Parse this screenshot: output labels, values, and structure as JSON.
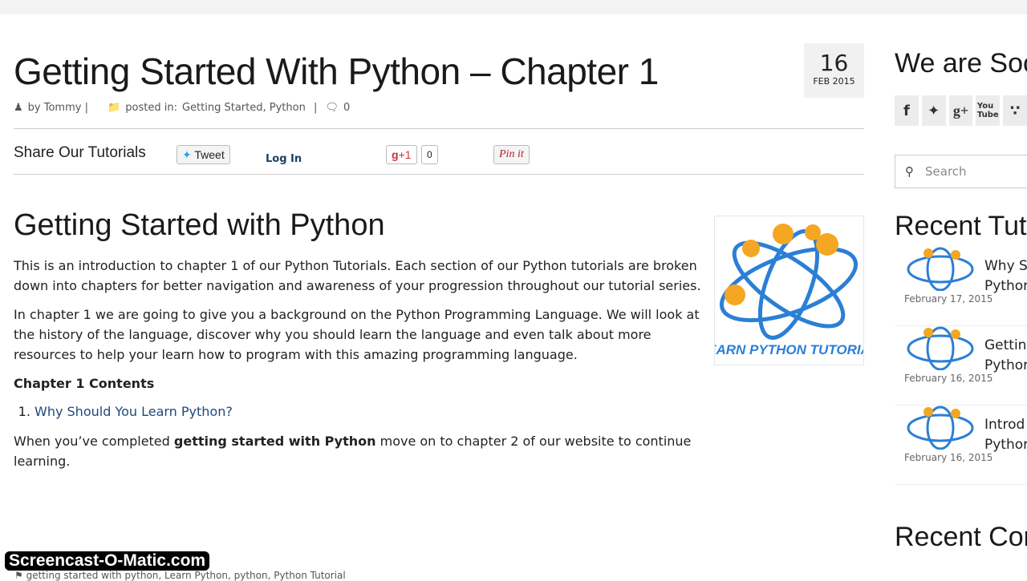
{
  "post": {
    "title": "Getting Started With Python – Chapter 1",
    "date_day": "16",
    "date_month": "FEB 2015",
    "author": "by Tommy |",
    "posted_in_label": "posted in:",
    "categories": "Getting Started, Python",
    "sep": "|",
    "comments": "0"
  },
  "share": {
    "label": "Share Our Tutorials",
    "tweet": "Tweet",
    "login": "Log In",
    "gplus": "+1",
    "gplus_count": "0",
    "pin": "Pin it"
  },
  "content": {
    "heading": "Getting Started with Python",
    "p1": "This is an introduction to chapter 1 of our Python Tutorials.  Each section of our Python tutorials are broken down into chapters for better navigation and awareness of your progression throughout our tutorial series.",
    "p2": "In chapter 1 we are going to give you a background on the Python Programming Language. We will look at the history of the language, discover why you should learn the language and even talk about more resources to help your learn how to program with this amazing programming language.",
    "contents_heading": "Chapter 1 Contents",
    "items": [
      "Why Should You Learn Python?"
    ],
    "p3_before": "When you’ve completed ",
    "p3_bold": "getting started with Python",
    "p3_after": " move on to chapter 2 of our website to continue learning.",
    "logo_text": "LEARN PYTHON TUTORIAL"
  },
  "sidebar": {
    "social_heading": "We are Soc",
    "search_placeholder": "Search",
    "recent_heading": "Recent Tut",
    "posts": [
      {
        "l1": "Why S",
        "l2": "Pythor",
        "date": "February 17, 2015"
      },
      {
        "l1": "Gettin",
        "l2": "Pythor",
        "date": "February 16, 2015"
      },
      {
        "l1": "Introd",
        "l2": "Pythor",
        "date": "February 16, 2015"
      }
    ],
    "comments_heading": "Recent Cor"
  },
  "tags": "getting started with python, Learn Python, python, Python Tutorial",
  "watermark": "Screencast-O-Matic.com"
}
